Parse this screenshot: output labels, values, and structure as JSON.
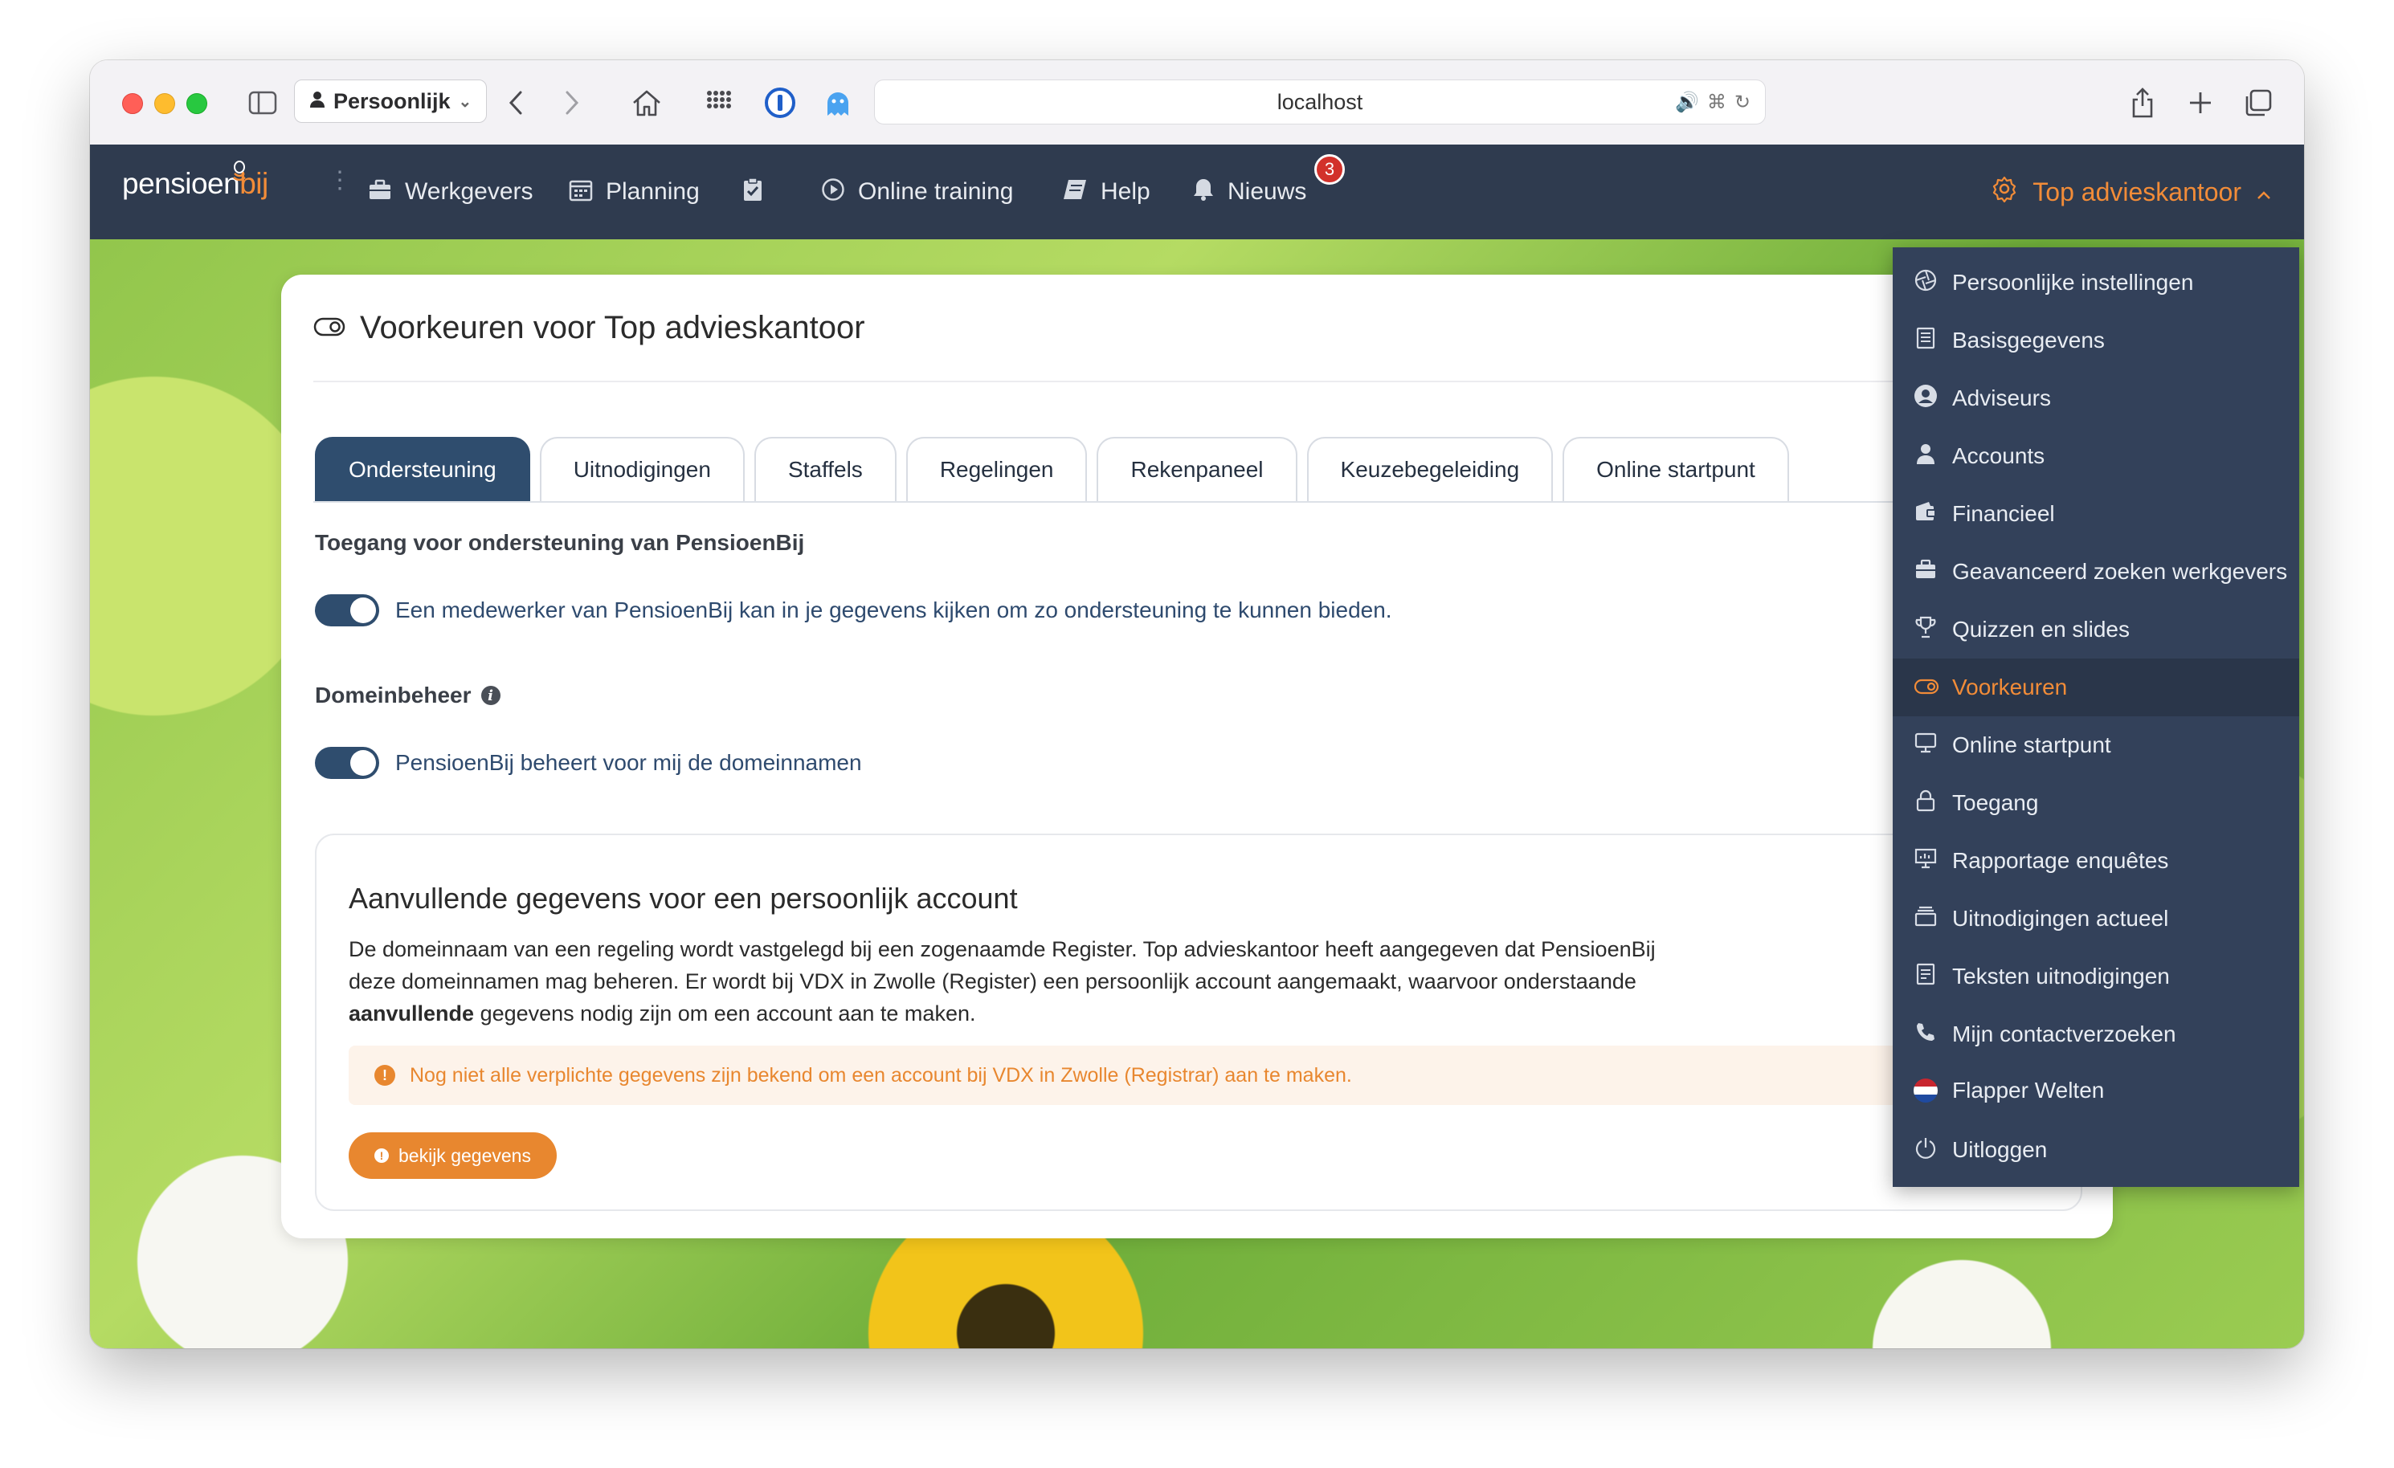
{
  "browser": {
    "profile_label": "Persoonlijk",
    "address": "localhost"
  },
  "nav": {
    "logo_main": "pensioen",
    "logo_accent": "bij",
    "items": [
      {
        "label": "Werkgevers",
        "icon": "briefcase-icon"
      },
      {
        "label": "Planning",
        "icon": "calendar-icon"
      },
      {
        "label": "",
        "icon": "clipboard-check-icon"
      },
      {
        "label": "Online training",
        "icon": "play-circle-icon"
      },
      {
        "label": "Help",
        "icon": "book-icon"
      },
      {
        "label": "Nieuws",
        "icon": "bell-icon"
      }
    ],
    "news_badge": "3",
    "account_label": "Top advieskantoor"
  },
  "card": {
    "title": "Voorkeuren voor Top advieskantoor",
    "tabs": [
      "Ondersteuning",
      "Uitnodigingen",
      "Staffels",
      "Regelingen",
      "Rekenpaneel",
      "Keuzebegeleiding",
      "Online startpunt"
    ],
    "active_tab": "Ondersteuning",
    "support_heading": "Toegang voor ondersteuning van PensioenBij",
    "support_toggle_label": "Een medewerker van PensioenBij kan in je gegevens kijken om zo ondersteuning te kunnen bieden.",
    "domain_heading": "Domeinbeheer",
    "domain_toggle_label": "PensioenBij beheert voor mij de domeinnamen",
    "extra": {
      "title": "Aanvullende gegevens voor een persoonlijk account",
      "text_part1": "De domeinnaam van een regeling wordt vastgelegd bij een zogenaamde Register. Top advieskantoor heeft aangegeven dat PensioenBij deze domeinnamen mag beheren. Er wordt bij VDX in Zwolle (Register) een persoonlijk account aangemaakt, waarvoor onderstaande ",
      "text_bold": "aanvullende",
      "text_part2": " gegevens nodig zijn om een account aan te maken.",
      "warning": "Nog niet alle verplichte gegevens zijn bekend om een account bij VDX in Zwolle (Registrar) aan te maken.",
      "button": "bekijk gegevens"
    }
  },
  "dropdown": {
    "items": [
      {
        "label": "Persoonlijke instellingen",
        "icon": "aperture-icon"
      },
      {
        "label": "Basisgegevens",
        "icon": "document-icon"
      },
      {
        "label": "Adviseurs",
        "icon": "user-circle-icon"
      },
      {
        "label": "Accounts",
        "icon": "user-icon"
      },
      {
        "label": "Financieel",
        "icon": "wallet-icon"
      },
      {
        "label": "Geavanceerd zoeken werkgevers",
        "icon": "briefcase-icon"
      },
      {
        "label": "Quizzen en slides",
        "icon": "trophy-icon"
      },
      {
        "label": "Voorkeuren",
        "icon": "toggle-icon"
      },
      {
        "label": "Online startpunt",
        "icon": "monitor-icon"
      },
      {
        "label": "Toegang",
        "icon": "lock-icon"
      },
      {
        "label": "Rapportage enquêtes",
        "icon": "presentation-icon"
      },
      {
        "label": "Uitnodigingen actueel",
        "icon": "inbox-icon"
      },
      {
        "label": "Teksten uitnodigingen",
        "icon": "file-text-icon"
      },
      {
        "label": "Mijn contactverzoeken",
        "icon": "phone-icon"
      },
      {
        "label": "Flapper Welten",
        "icon": "nl-flag-icon"
      },
      {
        "label": "Uitloggen",
        "icon": "power-icon"
      }
    ],
    "active": "Voorkeuren"
  },
  "colors": {
    "nav_bg": "#2f3b4f",
    "accent_orange": "#f28c38",
    "tab_active": "#2f4d6e",
    "dropdown_bg": "#33415a"
  }
}
